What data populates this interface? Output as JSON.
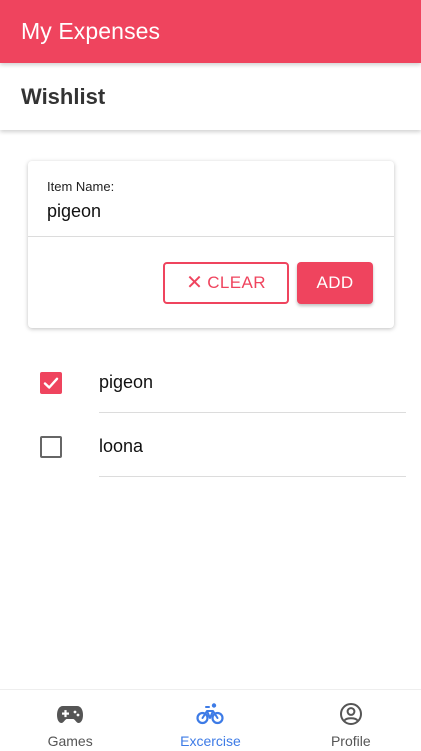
{
  "app": {
    "title": "My Expenses"
  },
  "page": {
    "title": "Wishlist"
  },
  "form": {
    "label": "Item Name:",
    "value": "pigeon",
    "clear_label": "CLEAR",
    "add_label": "ADD"
  },
  "items": [
    {
      "label": "pigeon",
      "checked": true
    },
    {
      "label": "loona",
      "checked": false
    }
  ],
  "nav": [
    {
      "label": "Games",
      "icon": "gamepad-icon",
      "active": false
    },
    {
      "label": "Excercise",
      "icon": "bicycle-icon",
      "active": true
    },
    {
      "label": "Profile",
      "icon": "account-circle-icon",
      "active": false
    }
  ],
  "colors": {
    "accent": "#ef445e",
    "nav_active": "#3d7be6"
  }
}
